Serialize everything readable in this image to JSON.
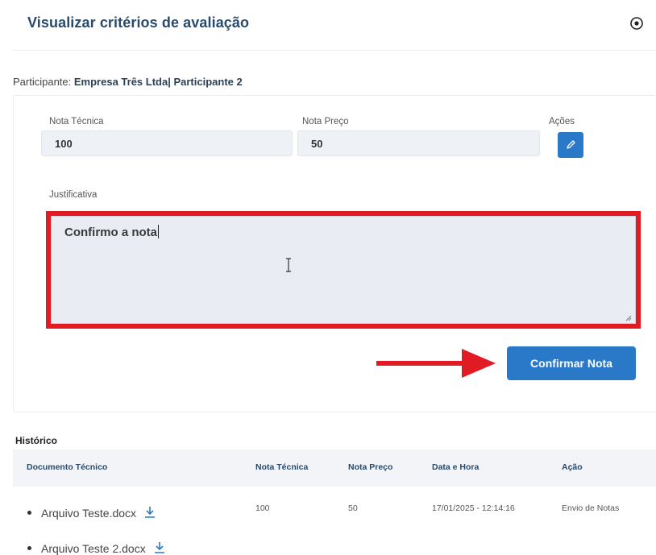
{
  "modal": {
    "title": "Visualizar critérios de avaliação",
    "close_icon": "close-circle-icon"
  },
  "participant": {
    "label": "Participante:",
    "value": "Empresa Três Ltda| Participante 2"
  },
  "form": {
    "nota_tecnica_label": "Nota Técnica",
    "nota_tecnica_value": "100",
    "nota_preco_label": "Nota Preço",
    "nota_preco_value": "50",
    "acoes_label": "Ações",
    "edit_icon": "pencil-icon",
    "justificativa_label": "Justificativa",
    "justificativa_value": "Confirmo a nota",
    "confirm_label": "Confirmar Nota"
  },
  "historico": {
    "title": "Histórico",
    "columns": [
      "Documento Técnico",
      "Nota Técnica",
      "Nota Preço",
      "Data e Hora",
      "Ação"
    ],
    "documents": [
      "Arquivo Teste.docx",
      "Arquivo Teste 2.docx"
    ],
    "rows": [
      {
        "nota_tecnica": "100",
        "nota_preco": "50",
        "data_hora": "17/01/2025 - 12:14:16",
        "acao": "Envio de Notas"
      }
    ]
  },
  "colors": {
    "primary": "#2a79c8",
    "highlight": "#e01b24",
    "title": "#2a4a6b"
  }
}
